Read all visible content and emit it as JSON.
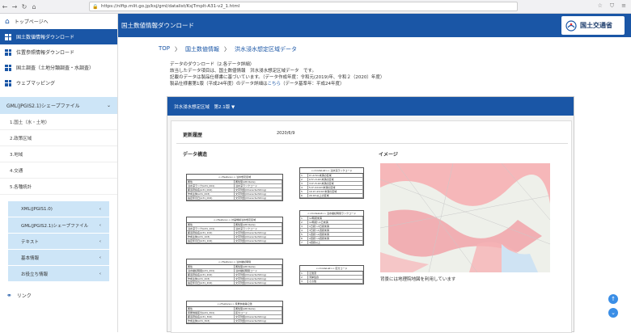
{
  "browser": {
    "url": "https://nlftp.mlit.go.jp/ksj/gml/datalist/KsjTmplt-A31-v2_1.html"
  },
  "header": {
    "title": "国土数値情報ダウンロード",
    "logo_text": "国土交通省"
  },
  "sidebar": {
    "top": "トップページへ",
    "items": [
      "国土数値情報ダウンロード",
      "位置参照情報ダウンロード",
      "国土調査（土地分類調査・水調査）",
      "ウェブマッピング"
    ],
    "section": "GML(JPGIS2.1)シェープファイル",
    "sub_items": [
      "1.国土（水・土地）",
      "2.政策区域",
      "3.地域",
      "4.交通",
      "5.各種統計"
    ],
    "accordions": [
      "XML(JPGIS1.0)",
      "GML(JPGIS2.1)シェープファイル",
      "テキスト",
      "基本情報",
      "お役立ち情報"
    ],
    "link": "リンク"
  },
  "breadcrumb": {
    "top": "TOP",
    "sep1": "〉",
    "info": "国土数値情報",
    "sep2": "〉",
    "current": "洪水浸水想定区域データ"
  },
  "description": {
    "line1": "データのダウンロード（2.各データ詳細）",
    "line2": "該当したデータ項目は、国土数値情報　洪水浸水想定区域データ　です。",
    "line3": "記載のデータは製品仕様書に基づいています。（データ作成年度：令和元(2019)年、令和２（2020）年度）",
    "line4a": "製品仕様書第1版（平成24年度）のデータ詳細は",
    "line4link": "こちら",
    "line4b": "（データ基準年：平成24年度）"
  },
  "panel": {
    "header": "洪水浸水想定区域　第2.1版 ▼",
    "history_label": "更新履歴",
    "history_value": "2020/6/9",
    "data_label": "データ構造",
    "image_label": "イメージ",
    "map_caption": "背景には地理院地図を利用しています"
  },
  "tables": [
    {
      "title": "<<Feature>> 浸水想定区域",
      "rows": [
        [
          "属性",
          "属性型(Attribute)"
        ],
        [
          "浸水深ランク(A31_001)",
          "浸水深ランクコード"
        ],
        [
          "都道府県名(A31_002)",
          "文字列型(CharacterString)"
        ],
        [
          "作成主体(A31_003)",
          "文字列型(CharacterString)"
        ],
        [
          "指定年月日(A31_004)",
          "文字列型(CharacterString)"
        ]
      ]
    },
    {
      "title": "<<Feature>> 計画規模浸水想定区域",
      "rows": [
        [
          "属性",
          "属性型(Attribute)"
        ],
        [
          "浸水深ランク(A31_101)",
          "浸水深ランクコード"
        ],
        [
          "都道府県名(A31_102)",
          "文字列型(CharacterString)"
        ],
        [
          "作成主体(A31_103)",
          "文字列型(CharacterString)"
        ],
        [
          "指定年月日(A31_104)",
          "文字列型(CharacterString)"
        ]
      ]
    },
    {
      "title": "<<Feature>> 浸水継続時間",
      "rows": [
        [
          "属性",
          "属性型(Attribute)"
        ],
        [
          "浸水継続時間(A31_201)",
          "浸水継続時間コード"
        ],
        [
          "都道府県名(A31_202)",
          "文字列型(CharacterString)"
        ],
        [
          "作成主体(A31_203)",
          "文字列型(CharacterString)"
        ],
        [
          "指定年月日(A31_204)",
          "文字列型(CharacterString)"
        ]
      ]
    },
    {
      "title": "<<Feature>> 家屋倒壊等氾濫",
      "rows": [
        [
          "属性",
          "属性型(Attribute)"
        ],
        [
          "家屋倒壊区分(A31_301)",
          "区分コード"
        ],
        [
          "都道府県名(A31_302)",
          "文字列型(CharacterString)"
        ],
        [
          "作成主体(A31_303)",
          "文字列型(CharacterString)"
        ]
      ]
    },
    {
      "title": "<<CodeList>> 浸水深ランクコード",
      "rows": [
        [
          "1",
          "0～0.5m未満の区域"
        ],
        [
          "2",
          "0.5～3.0m未満の区域"
        ],
        [
          "3",
          "3.0～5.0m未満の区域"
        ],
        [
          "4",
          "5.0～10.0m未満の区域"
        ],
        [
          "5",
          "10.0～20.0m未満の区域"
        ],
        [
          "6",
          "20.0m以上の区域"
        ]
      ]
    },
    {
      "title": "<<CodeList>> 浸水継続時間ランクコード",
      "rows": [
        [
          "1",
          "12時間未満"
        ],
        [
          "2",
          "12時間～1日未満"
        ],
        [
          "3",
          "1日間～3日間未満"
        ],
        [
          "4",
          "3日間～1週間未満"
        ],
        [
          "5",
          "1週間～2週間未満"
        ],
        [
          "6",
          "2週間～4週間未満"
        ],
        [
          "7",
          "4週間以上"
        ]
      ]
    },
    {
      "title": "<<CodeList>> 区分コード",
      "rows": [
        [
          "1",
          "氾濫流"
        ],
        [
          "2",
          "河岸侵食"
        ],
        [
          "3",
          "その他"
        ]
      ]
    }
  ]
}
